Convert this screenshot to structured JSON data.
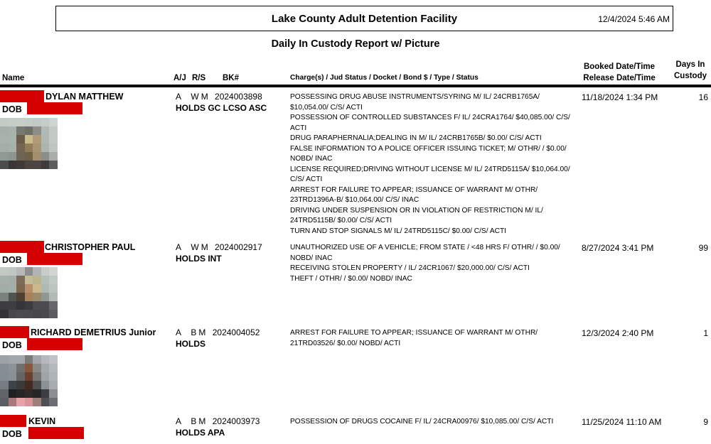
{
  "header": {
    "facility": "Lake County Adult Detention Facility",
    "report_datetime": "12/4/2024 5:46 AM",
    "subtitle": "Daily In Custody Report w/ Picture"
  },
  "columns": {
    "name": "Name",
    "aj": "A/J",
    "rs": "R/S",
    "bk": "BK#",
    "charges": "Charge(s) / Jud Status / Docket / Bond $ / Type / Status",
    "booked_line1": "Booked Date/Time",
    "booked_line2": "Release Date/Time",
    "days_line1": "Days In",
    "days_line2": "Custody"
  },
  "dob_label": "DOB",
  "redaction_color": "#d40000",
  "inmates": [
    {
      "name": "DYLAN MATTHEW",
      "aj": "A",
      "race": "W",
      "sex": "M",
      "bk": "2024003898",
      "holds": "HOLDS GC LCSO ASC",
      "booked": "11/18/2024 1:34 PM",
      "days": "16",
      "charges": [
        "POSSESSING DRUG ABUSE INSTRUMENTS/SYRING M/ IL/ 24CRB1765A/ $10,054.00/ C/S/ ACTI",
        "POSSESSION OF CONTROLLED SUBSTANCES F/ IL/ 24CRA1764/ $40,085.00/ C/S/ ACTI",
        "DRUG PARAPHERNALIA;DEALING IN M/ IL/ 24CRB1765B/ $0.00/ C/S/ ACTI",
        "FALSE INFORMATION TO A POLICE OFFICER ISSUING TICKET; M/ OTHR/ / $0.00/ NOBD/ INAC",
        "LICENSE REQUIRED;DRIVING WITHOUT LICENSE M/ IL/ 24TRD5115A/ $10,064.00/ C/S/ ACTI",
        "ARREST FOR FAILURE TO APPEAR; ISSUANCE OF WARRANT M/ OTHR/ 23TRD1396A-B/ $10,064.00/ C/S/ INAC",
        "DRIVING UNDER SUSPENSION OR IN VIOLATION OF RESTRICTION M/ IL/ 24TRD5115B/ $0.00/ C/S/ ACTI",
        "TURN AND STOP SIGNALS M/ IL/ 24TRD5115C/ $0.00/ C/S/ ACTI"
      ],
      "photo_pixels": [
        [
          "#c4cbc6",
          "#c6ccc7",
          "#c7cdc8",
          "#c5cbc6",
          "#c3c9c4",
          "#c6ccc7",
          "#d0d4d0"
        ],
        [
          "#a5b0aa",
          "#a8b3ad",
          "#77786f",
          "#6f6f68",
          "#8b8d86",
          "#b1bbb5",
          "#c3cac5"
        ],
        [
          "#a7b2ac",
          "#a9b3ad",
          "#6b5c49",
          "#c9bb8c",
          "#b09a78",
          "#afb9b3",
          "#c2c9c4"
        ],
        [
          "#a3aea8",
          "#a6b1ab",
          "#746550",
          "#927d59",
          "#a99473",
          "#acb6b0",
          "#bfc6c1"
        ],
        [
          "#909a94",
          "#8c958f",
          "#6c6556",
          "#6f6048",
          "#a48f6d",
          "#8a8f89",
          "#a9aeaa"
        ],
        [
          "#4c4c4c",
          "#3a3636",
          "#403a36",
          "#4b4540",
          "#4a4442",
          "#3f3b3b",
          "#5d5e5e"
        ]
      ]
    },
    {
      "name": "CHRISTOPHER PAUL",
      "aj": "A",
      "race": "W",
      "sex": "M",
      "bk": "2024002917",
      "holds": "HOLDS INT",
      "booked": "8/27/2024 3:41 PM",
      "days": "99",
      "charges": [
        "UNAUTHORIZED USE OF A VEHICLE; FROM STATE / <48 HRS F/ OTHR/ / $0.00/ NOBD/ INAC",
        "RECEIVING STOLEN PROPERTY / IL/ 24CR1067/ $20,000.00/ C/S/ ACTI",
        "THEFT / OTHR/ / $0.00/ NOBD/ INAC"
      ],
      "photo_pixels": [
        [
          "#c3c8c5",
          "#c0c6c3",
          "#b5b8b6",
          "#8e8e8e",
          "#b1b3b9",
          "#c8ccca",
          "#d2d6d3"
        ],
        [
          "#a6b0aa",
          "#a4aea8",
          "#7d6a58",
          "#c4bc96",
          "#bbb58f",
          "#b5bfb9",
          "#c1c9c4"
        ],
        [
          "#a3ada7",
          "#a5afa9",
          "#7b6650",
          "#b88f6c",
          "#cdb88e",
          "#adb9b3",
          "#bcc5bf"
        ],
        [
          "#7b827e",
          "#4f5451",
          "#4d3f31",
          "#a8805c",
          "#9a8c6a",
          "#909893",
          "#b3bab6"
        ],
        [
          "#3d3d3f",
          "#3e3e41",
          "#353538",
          "#3c3b3e",
          "#4c4b50",
          "#4b4a4f",
          "#67676b"
        ],
        [
          "#343436",
          "#48484c",
          "#4b4b4f",
          "#4a4a4e",
          "#47474b",
          "#49494d",
          "#5c5c60"
        ]
      ]
    },
    {
      "name": "RICHARD DEMETRIUS Junior",
      "aj": "A",
      "race": "B",
      "sex": "M",
      "bk": "2024004052",
      "holds": "HOLDS",
      "booked": "12/3/2024 2:40 PM",
      "days": "1",
      "charges": [
        "ARREST FOR FAILURE TO APPEAR; ISSUANCE OF WARRANT M/ OTHR/ 21TRD03526/ $0.00/ NOBD/ ACTI"
      ],
      "photo_pixels": [
        [
          "#9da2a6",
          "#a1a6aa",
          "#a3a7ab",
          "#7b7c78",
          "#a3a6aa",
          "#b5b9bd",
          "#c0c3c6"
        ],
        [
          "#868d93",
          "#8b9298",
          "#6f6f70",
          "#86573c",
          "#8b8885",
          "#a3a9ad",
          "#b4b8bb"
        ],
        [
          "#858c92",
          "#899096",
          "#656465",
          "#6a3f2d",
          "#777473",
          "#9ea4a8",
          "#b0b4b8"
        ],
        [
          "#767c82",
          "#3e4347",
          "#3a3a3b",
          "#43291f",
          "#4f4f50",
          "#8c9196",
          "#a8acb0"
        ],
        [
          "#61656a",
          "#1f2022",
          "#262626",
          "#2e2a28",
          "#262626",
          "#3b3d40",
          "#8b8f93"
        ],
        [
          "#5a5d61",
          "#a77a7d",
          "#e6a4aa",
          "#d89498",
          "#9d7f80",
          "#4f5054",
          "#6c6f72"
        ]
      ]
    },
    {
      "name": "KEVIN",
      "aj": "A",
      "race": "B",
      "sex": "M",
      "bk": "2024003973",
      "holds": "HOLDS APA",
      "booked": "11/25/2024 11:10 AM",
      "days": "9",
      "charges": [
        "POSSESSION OF DRUGS COCAINE F/ IL/ 24CRA00976/ $10,085.00/ C/S/ ACTI"
      ],
      "photo_pixels": []
    }
  ]
}
